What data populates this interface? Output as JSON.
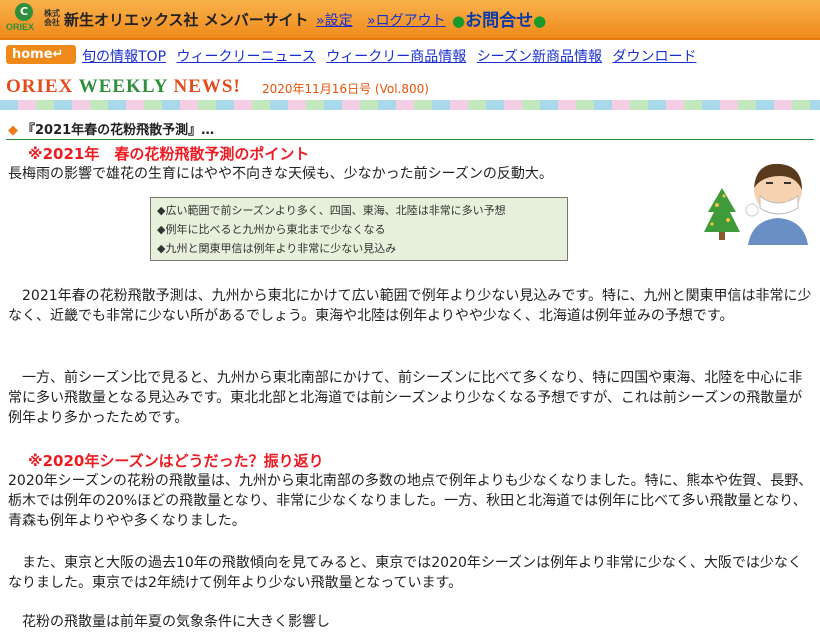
{
  "header": {
    "logo_text": "ORIEX",
    "corp_prefix": "株式会社",
    "site_title": "新生オリエックス社 メンバーサイト",
    "settings_link": "»設定",
    "logout_link": "»ログアウト",
    "contact_label": "お問合せ"
  },
  "nav": {
    "home_label": "home↵",
    "items": [
      {
        "label": "旬の情報TOP"
      },
      {
        "label": "ウィークリーニュース"
      },
      {
        "label": "ウィークリー商品情報"
      },
      {
        "label": "シーズン新商品情報"
      },
      {
        "label": "ダウンロード"
      }
    ]
  },
  "banner": {
    "title_part1": "ORIEX ",
    "title_part2": "WEEKLY ",
    "title_part3": "NEWS!",
    "issue": "2020年11月16日号 (Vol.800)"
  },
  "article": {
    "section_title": "『2021年春の花粉飛散予測』…",
    "heading1": "※2021年　春の花粉飛散予測のポイント",
    "lead": "長梅雨の影響で雄花の生育にはやや不向きな天候も、少なかった前シーズンの反動大。",
    "summary": [
      "◆広い範囲で前シーズンより多く、四国、東海、北陸は非常に多い予想",
      "◆例年に比べると九州から東北まで少なくなる",
      "◆九州と関東甲信は例年より非常に少ない見込み"
    ],
    "para1": "2021年春の花粉飛散予測は、九州から東北にかけて広い範囲で例年より少ない見込みです。特に、九州と関東甲信は非常に少なく、近畿でも非常に少ない所があるでしょう。東海や北陸は例年よりやや少なく、北海道は例年並みの予想です。",
    "para2": "一方、前シーズン比で見ると、九州から東北南部にかけて、前シーズンに比べて多くなり、特に四国や東海、北陸を中心に非常に多い飛散量となる見込みです。東北北部と北海道では前シーズンより少なくなる予想ですが、これは前シーズンの飛散量が例年より多かったためです。",
    "heading2": "※2020年シーズンはどうだった？振り返り",
    "para3": "2020年シーズンの花粉の飛散量は、九州から東北南部の多数の地点で例年よりも少なくなりました。特に、熊本や佐賀、長野、栃木では例年の20%ほどの飛散量となり、非常に少なくなりました。一方、秋田と北海道では例年に比べて多い飛散量となり、青森も例年よりやや多くなりました。",
    "para4": "また、東京と大阪の過去10年の飛散傾向を見てみると、東京では2020年シーズンは例年より非常に少なく、大阪では少なくなりました。東京では2年続けて例年より少ない飛散量となっています。",
    "para5": "花粉の飛散量は前年夏の気象条件に大きく影響し"
  },
  "colors": {
    "header_orange": "#f08a1c",
    "link_blue": "#1a2fd0",
    "heading_red": "#ec1c24",
    "accent_green": "#2f8f3a"
  }
}
